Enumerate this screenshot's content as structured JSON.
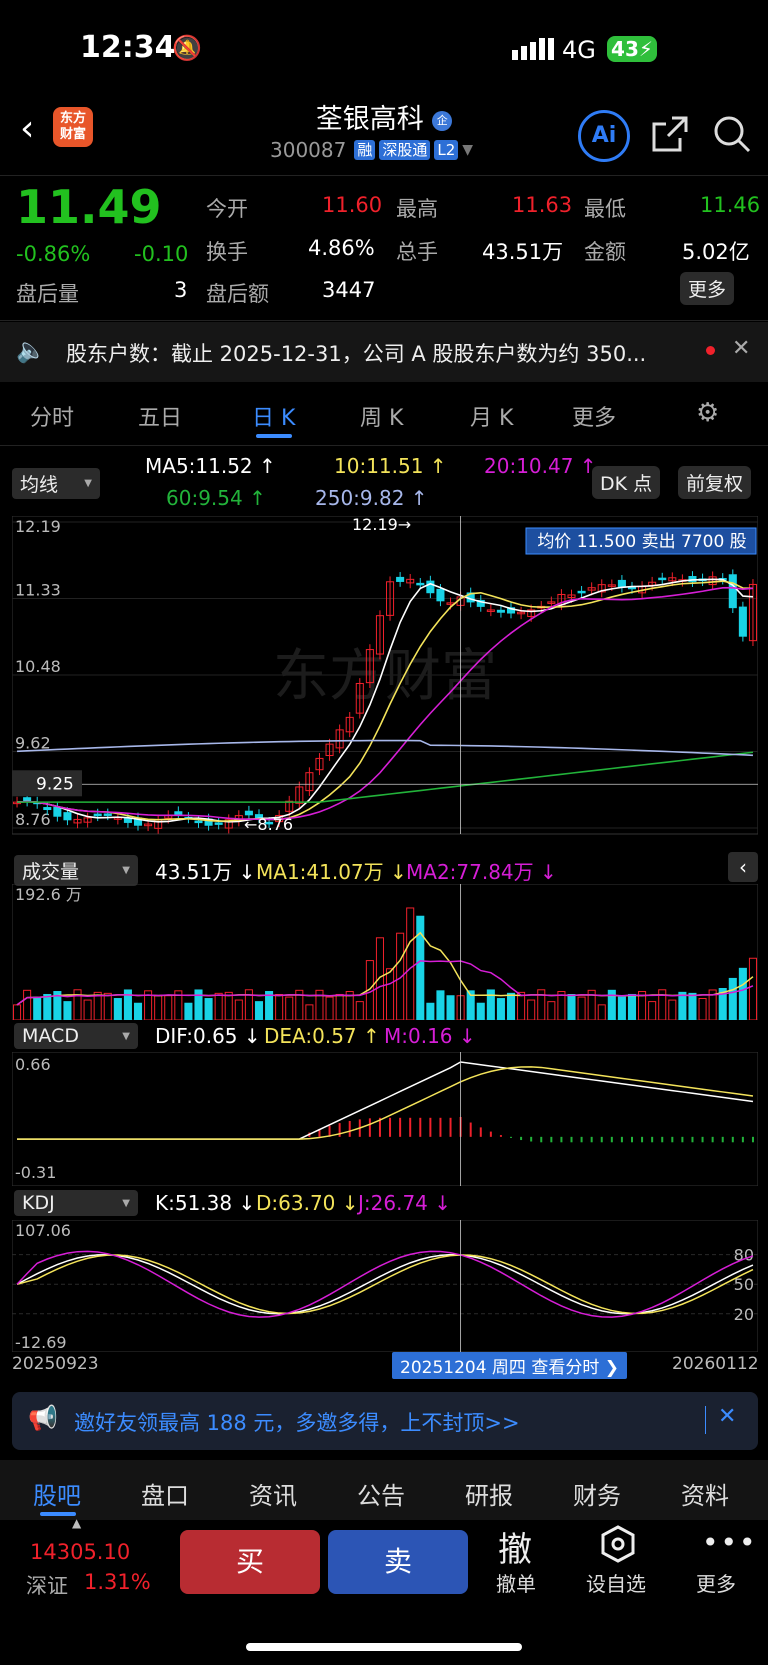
{
  "status_bar": {
    "time": "12:34",
    "network": "4G",
    "battery": "43"
  },
  "header": {
    "title": "荃银高科",
    "code": "300087",
    "tags": [
      "融",
      "深股通",
      "L2"
    ],
    "logo_text": "东方\n财富"
  },
  "quote": {
    "price": "11.49",
    "change_pct": "-0.86%",
    "change": "-0.10",
    "open_label": "今开",
    "open": "11.60",
    "high_label": "最高",
    "high": "11.63",
    "low_label": "最低",
    "low": "11.46",
    "turnover_label": "换手",
    "turnover": "4.86%",
    "volume_label": "总手",
    "volume": "43.51万",
    "amount_label": "金额",
    "amount": "5.02亿",
    "after_vol_label": "盘后量",
    "after_vol": "3",
    "after_amt_label": "盘后额",
    "after_amt": "3447",
    "more": "更多"
  },
  "notice": {
    "text": "股东户数：截止 2025-12-31，公司 A 股股东户数为约 350..."
  },
  "tabs": [
    "分时",
    "五日",
    "日 K",
    "周 K",
    "月 K",
    "更多"
  ],
  "active_tab": "日 K",
  "ma_bar": {
    "select": "均线",
    "ma5": "MA5:11.52 ↑",
    "ma10": "10:11.51 ↑",
    "ma20": "20:10.47 ↑",
    "ma60": "60:9.54 ↑",
    "ma250": "250:9.82 ↑",
    "dk": "DK 点",
    "fq": "前复权"
  },
  "kline": {
    "y_labels": [
      "12.19",
      "11.33",
      "10.48",
      "9.62",
      "8.76"
    ],
    "max_marker": "12.19→",
    "min_marker": "←8.76",
    "cursor_price": "9.25",
    "tooltip": "均价 11.500  卖出 7700 股",
    "watermark": "东方财富",
    "colors": {
      "up": "#f0212b",
      "down": "#19d3e6",
      "ma5": "#ffffff",
      "ma10": "#f3e35a",
      "ma20": "#d61ed6",
      "ma60": "#22b33a",
      "ma250": "#a7b7ea"
    }
  },
  "volume": {
    "select": "成交量",
    "vol": "43.51万 ↓",
    "ma1": "MA1:41.07万 ↓",
    "ma2": "MA2:77.84万 ↓",
    "max": "192.6 万"
  },
  "macd": {
    "select": "MACD",
    "dif": "DIF:0.65 ↓",
    "dea": "DEA:0.57 ↑",
    "m": "M:0.16 ↓",
    "max": "0.66",
    "min": "-0.31"
  },
  "kdj": {
    "select": "KDJ",
    "k": "K:51.38 ↓",
    "d": "D:63.70 ↓",
    "j": "J:26.74 ↓",
    "max": "107.06",
    "min": "-12.69",
    "levels": [
      "80",
      "50",
      "20"
    ]
  },
  "dates": {
    "start": "20250923",
    "cursor": "20251204 周四 查看分时 ❯",
    "end": "20260112"
  },
  "promo": {
    "text": "邀好友领最高 188 元，多邀多得，上不封顶>>"
  },
  "bottom_tabs": [
    "股吧",
    "盘口",
    "资讯",
    "公告",
    "研报",
    "财务",
    "资料"
  ],
  "bottom_bar": {
    "index_value": "14305.10",
    "index_name": "深证",
    "index_pct": "1.31%",
    "buy": "买",
    "sell": "卖",
    "cancel_icon": "撤",
    "cancel": "撤单",
    "watch": "设自选",
    "more": "更多"
  }
}
